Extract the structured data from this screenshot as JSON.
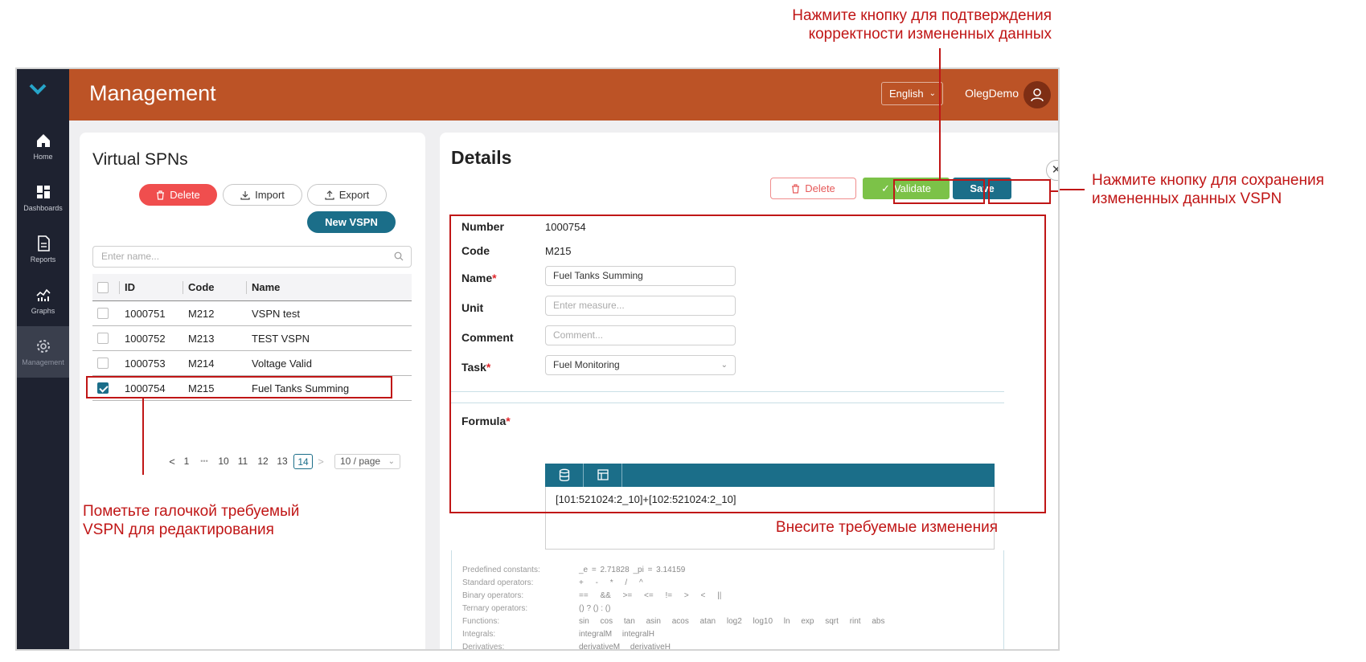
{
  "sidebar": {
    "items": [
      {
        "label": "Home",
        "icon": "home-icon"
      },
      {
        "label": "Dashboards",
        "icon": "dashboard-icon"
      },
      {
        "label": "Reports",
        "icon": "report-icon"
      },
      {
        "label": "Graphs",
        "icon": "graph-icon"
      },
      {
        "label": "Management",
        "icon": "gear-icon"
      }
    ]
  },
  "header": {
    "title": "Management",
    "language": "English",
    "username": "OlegDemo"
  },
  "list": {
    "title": "Virtual SPNs",
    "delete_label": "Delete",
    "import_label": "Import",
    "export_label": "Export",
    "new_label": "New VSPN",
    "search_placeholder": "Enter name...",
    "columns": [
      "ID",
      "Code",
      "Name"
    ],
    "rows": [
      {
        "id": "1000751",
        "code": "M212",
        "name": "VSPN test",
        "checked": false
      },
      {
        "id": "1000752",
        "code": "M213",
        "name": "TEST VSPN",
        "checked": false
      },
      {
        "id": "1000753",
        "code": "M214",
        "name": "Voltage Valid",
        "checked": false
      },
      {
        "id": "1000754",
        "code": "M215",
        "name": "Fuel Tanks Summing",
        "checked": true
      }
    ],
    "pagination": {
      "prev": "<",
      "first": "1",
      "ellipsis": "•••",
      "pages": [
        "10",
        "11",
        "12",
        "13"
      ],
      "current": "14",
      "next": ">",
      "page_size": "10 / page"
    }
  },
  "details": {
    "title": "Details",
    "delete_label": "Delete",
    "validate_label": "Validate",
    "save_label": "Save",
    "number_label": "Number",
    "number_value": "1000754",
    "code_label": "Code",
    "code_value": "M215",
    "name_label": "Name",
    "name_value": "Fuel Tanks Summing",
    "unit_label": "Unit",
    "unit_placeholder": "Enter measure...",
    "comment_label": "Comment",
    "comment_placeholder": "Comment...",
    "task_label": "Task",
    "task_value": "Fuel Monitoring",
    "required_mark": "*",
    "formula_label": "Formula",
    "formula_value": "[101:521024:2_10]+[102:521024:2_10]",
    "reference": [
      {
        "label": "Predefined constants:",
        "value": "_e = 2.71828   _pi = 3.14159"
      },
      {
        "label": "Standard operators:",
        "value": "+ - * / ^"
      },
      {
        "label": "Binary operators:",
        "value": "== && >= <= != > < ||"
      },
      {
        "label": "Ternary operators:",
        "value": "() ? () : ()"
      },
      {
        "label": "Functions:",
        "value": "sin cos tan asin acos atan log2 log10 ln exp sqrt rint abs"
      },
      {
        "label": "Integrals:",
        "value": "integralM integralH"
      },
      {
        "label": "Derivatives:",
        "value": "derivativeM derivativeH"
      }
    ]
  },
  "annotations": {
    "validate_line1": "Нажмите кнопку для подтверждения",
    "validate_line2": "корректности измененных данных",
    "save_line1": "Нажмите кнопку для сохранения",
    "save_line2": "измененных данных VSPN",
    "select_line1": "Пометьте галочкой требуемый",
    "select_line2": "VSPN для редактирования",
    "edit": "Внесите требуемые изменения"
  },
  "colors": {
    "header": "#bc5326",
    "sidebar": "#1e2230",
    "primary": "#1b6e89",
    "validate": "#7cc248",
    "danger": "#f04e4e",
    "annotation": "#c01616"
  }
}
